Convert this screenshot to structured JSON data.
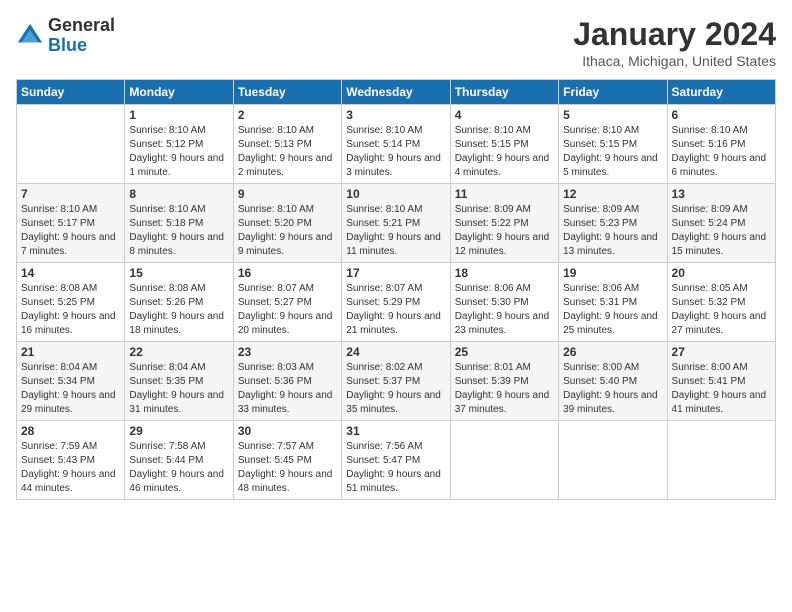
{
  "logo": {
    "general": "General",
    "blue": "Blue"
  },
  "title": "January 2024",
  "location": "Ithaca, Michigan, United States",
  "days_of_week": [
    "Sunday",
    "Monday",
    "Tuesday",
    "Wednesday",
    "Thursday",
    "Friday",
    "Saturday"
  ],
  "weeks": [
    [
      {
        "day": "",
        "sunrise": "",
        "sunset": "",
        "daylight": ""
      },
      {
        "day": "1",
        "sunrise": "Sunrise: 8:10 AM",
        "sunset": "Sunset: 5:12 PM",
        "daylight": "Daylight: 9 hours and 1 minute."
      },
      {
        "day": "2",
        "sunrise": "Sunrise: 8:10 AM",
        "sunset": "Sunset: 5:13 PM",
        "daylight": "Daylight: 9 hours and 2 minutes."
      },
      {
        "day": "3",
        "sunrise": "Sunrise: 8:10 AM",
        "sunset": "Sunset: 5:14 PM",
        "daylight": "Daylight: 9 hours and 3 minutes."
      },
      {
        "day": "4",
        "sunrise": "Sunrise: 8:10 AM",
        "sunset": "Sunset: 5:15 PM",
        "daylight": "Daylight: 9 hours and 4 minutes."
      },
      {
        "day": "5",
        "sunrise": "Sunrise: 8:10 AM",
        "sunset": "Sunset: 5:15 PM",
        "daylight": "Daylight: 9 hours and 5 minutes."
      },
      {
        "day": "6",
        "sunrise": "Sunrise: 8:10 AM",
        "sunset": "Sunset: 5:16 PM",
        "daylight": "Daylight: 9 hours and 6 minutes."
      }
    ],
    [
      {
        "day": "7",
        "sunrise": "Sunrise: 8:10 AM",
        "sunset": "Sunset: 5:17 PM",
        "daylight": "Daylight: 9 hours and 7 minutes."
      },
      {
        "day": "8",
        "sunrise": "Sunrise: 8:10 AM",
        "sunset": "Sunset: 5:18 PM",
        "daylight": "Daylight: 9 hours and 8 minutes."
      },
      {
        "day": "9",
        "sunrise": "Sunrise: 8:10 AM",
        "sunset": "Sunset: 5:20 PM",
        "daylight": "Daylight: 9 hours and 9 minutes."
      },
      {
        "day": "10",
        "sunrise": "Sunrise: 8:10 AM",
        "sunset": "Sunset: 5:21 PM",
        "daylight": "Daylight: 9 hours and 11 minutes."
      },
      {
        "day": "11",
        "sunrise": "Sunrise: 8:09 AM",
        "sunset": "Sunset: 5:22 PM",
        "daylight": "Daylight: 9 hours and 12 minutes."
      },
      {
        "day": "12",
        "sunrise": "Sunrise: 8:09 AM",
        "sunset": "Sunset: 5:23 PM",
        "daylight": "Daylight: 9 hours and 13 minutes."
      },
      {
        "day": "13",
        "sunrise": "Sunrise: 8:09 AM",
        "sunset": "Sunset: 5:24 PM",
        "daylight": "Daylight: 9 hours and 15 minutes."
      }
    ],
    [
      {
        "day": "14",
        "sunrise": "Sunrise: 8:08 AM",
        "sunset": "Sunset: 5:25 PM",
        "daylight": "Daylight: 9 hours and 16 minutes."
      },
      {
        "day": "15",
        "sunrise": "Sunrise: 8:08 AM",
        "sunset": "Sunset: 5:26 PM",
        "daylight": "Daylight: 9 hours and 18 minutes."
      },
      {
        "day": "16",
        "sunrise": "Sunrise: 8:07 AM",
        "sunset": "Sunset: 5:27 PM",
        "daylight": "Daylight: 9 hours and 20 minutes."
      },
      {
        "day": "17",
        "sunrise": "Sunrise: 8:07 AM",
        "sunset": "Sunset: 5:29 PM",
        "daylight": "Daylight: 9 hours and 21 minutes."
      },
      {
        "day": "18",
        "sunrise": "Sunrise: 8:06 AM",
        "sunset": "Sunset: 5:30 PM",
        "daylight": "Daylight: 9 hours and 23 minutes."
      },
      {
        "day": "19",
        "sunrise": "Sunrise: 8:06 AM",
        "sunset": "Sunset: 5:31 PM",
        "daylight": "Daylight: 9 hours and 25 minutes."
      },
      {
        "day": "20",
        "sunrise": "Sunrise: 8:05 AM",
        "sunset": "Sunset: 5:32 PM",
        "daylight": "Daylight: 9 hours and 27 minutes."
      }
    ],
    [
      {
        "day": "21",
        "sunrise": "Sunrise: 8:04 AM",
        "sunset": "Sunset: 5:34 PM",
        "daylight": "Daylight: 9 hours and 29 minutes."
      },
      {
        "day": "22",
        "sunrise": "Sunrise: 8:04 AM",
        "sunset": "Sunset: 5:35 PM",
        "daylight": "Daylight: 9 hours and 31 minutes."
      },
      {
        "day": "23",
        "sunrise": "Sunrise: 8:03 AM",
        "sunset": "Sunset: 5:36 PM",
        "daylight": "Daylight: 9 hours and 33 minutes."
      },
      {
        "day": "24",
        "sunrise": "Sunrise: 8:02 AM",
        "sunset": "Sunset: 5:37 PM",
        "daylight": "Daylight: 9 hours and 35 minutes."
      },
      {
        "day": "25",
        "sunrise": "Sunrise: 8:01 AM",
        "sunset": "Sunset: 5:39 PM",
        "daylight": "Daylight: 9 hours and 37 minutes."
      },
      {
        "day": "26",
        "sunrise": "Sunrise: 8:00 AM",
        "sunset": "Sunset: 5:40 PM",
        "daylight": "Daylight: 9 hours and 39 minutes."
      },
      {
        "day": "27",
        "sunrise": "Sunrise: 8:00 AM",
        "sunset": "Sunset: 5:41 PM",
        "daylight": "Daylight: 9 hours and 41 minutes."
      }
    ],
    [
      {
        "day": "28",
        "sunrise": "Sunrise: 7:59 AM",
        "sunset": "Sunset: 5:43 PM",
        "daylight": "Daylight: 9 hours and 44 minutes."
      },
      {
        "day": "29",
        "sunrise": "Sunrise: 7:58 AM",
        "sunset": "Sunset: 5:44 PM",
        "daylight": "Daylight: 9 hours and 46 minutes."
      },
      {
        "day": "30",
        "sunrise": "Sunrise: 7:57 AM",
        "sunset": "Sunset: 5:45 PM",
        "daylight": "Daylight: 9 hours and 48 minutes."
      },
      {
        "day": "31",
        "sunrise": "Sunrise: 7:56 AM",
        "sunset": "Sunset: 5:47 PM",
        "daylight": "Daylight: 9 hours and 51 minutes."
      },
      {
        "day": "",
        "sunrise": "",
        "sunset": "",
        "daylight": ""
      },
      {
        "day": "",
        "sunrise": "",
        "sunset": "",
        "daylight": ""
      },
      {
        "day": "",
        "sunrise": "",
        "sunset": "",
        "daylight": ""
      }
    ]
  ]
}
